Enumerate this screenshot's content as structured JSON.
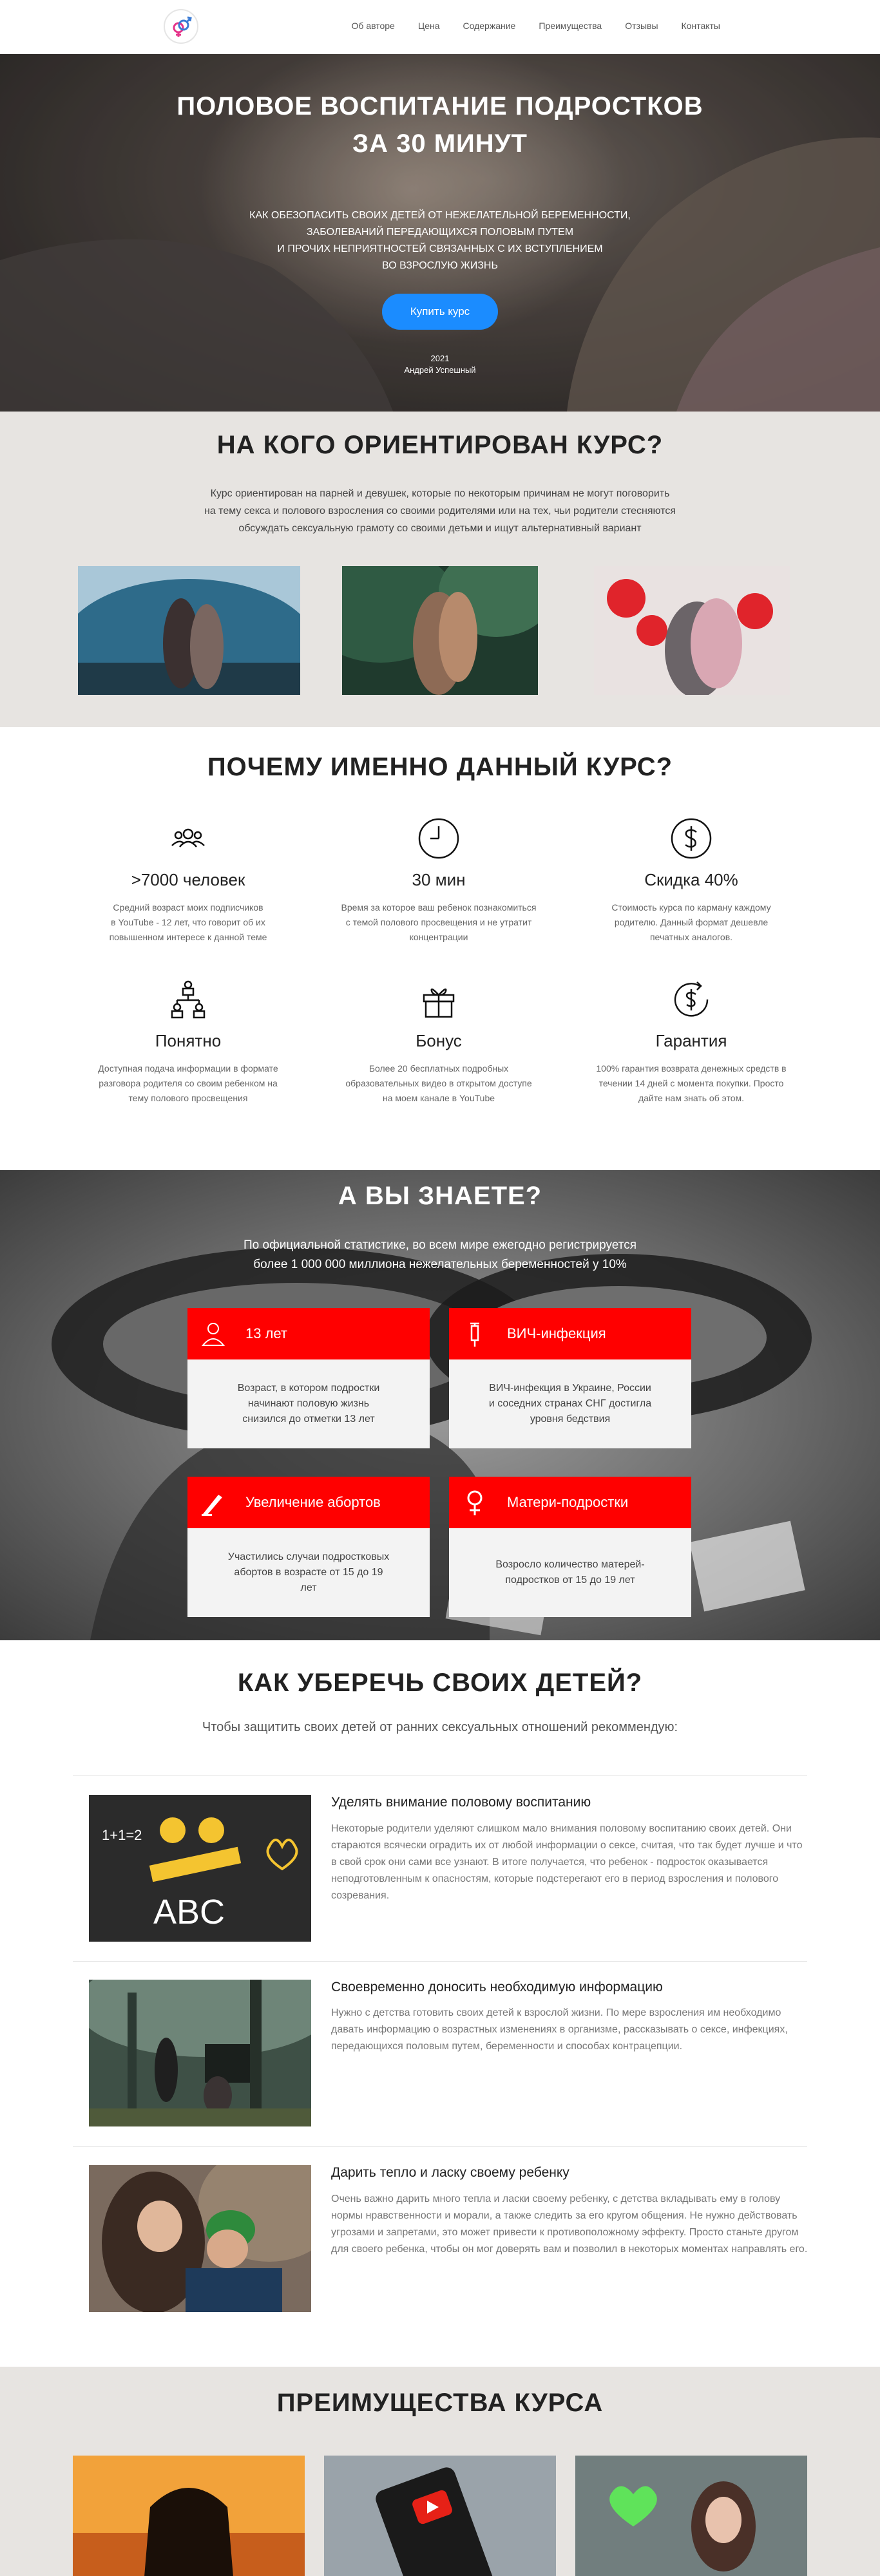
{
  "nav": {
    "items": [
      "Об авторе",
      "Цена",
      "Содержание",
      "Преимущества",
      "Отзывы",
      "Контакты"
    ]
  },
  "hero": {
    "title_line1": "ПОЛОВОЕ ВОСПИТАНИЕ ПОДРОСТКОВ",
    "title_line2": "ЗА 30 МИНУТ",
    "subtitle_lines": [
      "КАК ОБЕЗОПАСИТЬ СВОИХ ДЕТЕЙ ОТ НЕЖЕЛАТЕЛЬНОЙ БЕРЕМЕННОСТИ,",
      "ЗАБОЛЕВАНИЙ ПЕРЕДАЮЩИХСЯ ПОЛОВЫМ ПУТЕМ",
      "И ПРОЧИХ НЕПРИЯТНОСТЕЙ СВЯЗАННЫХ С ИХ ВСТУПЛЕНИЕМ",
      "ВО ВЗРОСЛУЮ ЖИЗНЬ"
    ],
    "button_label": "Купить курс",
    "year": "2021",
    "author": "Андрей Успешный"
  },
  "audience": {
    "title": "НА КОГО ОРИЕНТИРОВАН КУРС?",
    "desc_lines": [
      "Курс ориентирован на парней и девушек, которые по некоторым причинам не могут поговорить",
      "на тему секса и полового взросления со своими родителями или на тех, чьи родители стесняются",
      "обсуждать сексуальную грамоту со своими детьми и ищут альтернативный вариант"
    ]
  },
  "why": {
    "title": "ПОЧЕМУ ИМЕННО ДАННЫЙ КУРС?",
    "features": [
      {
        "icon": "people-icon",
        "title": ">7000 человек",
        "text": [
          "Средний возраст моих подписчиков",
          "в YouTube - 12 лет, что говорит об их",
          "повышенном интересе к данной теме"
        ]
      },
      {
        "icon": "clock-icon",
        "title": "30 мин",
        "text": [
          "Время за которое ваш ребенок познакомиться",
          "с темой полового просвещения и не утратит",
          "концентрации"
        ]
      },
      {
        "icon": "dollar-icon",
        "title": "Скидка 40%",
        "text": [
          "Стоимость курса по карману каждому",
          "родителю. Данный формат дешевле",
          "печатных аналогов."
        ]
      },
      {
        "icon": "network-icon",
        "title": "Понятно",
        "text": [
          "Доступная подача информации в формате",
          "разговора родителя со своим ребенком на",
          "тему полового просвещения"
        ]
      },
      {
        "icon": "gift-icon",
        "title": "Бонус",
        "text": [
          "Более 20 бесплатных подробных",
          "образовательных видео в открытом доступе",
          "на моем канале в YouTube"
        ]
      },
      {
        "icon": "money-back-icon",
        "title": "Гарантия",
        "text": [
          "100% гарантия возврата денежных средств в",
          "течении 14 дней с момента покупки. Просто",
          "дайте нам знать об этом."
        ]
      }
    ]
  },
  "facts": {
    "title": "А ВЫ ЗНАЕТЕ?",
    "desc_lines": [
      "По официальной статистике, во всем мире ежегодно регистрируется",
      "более 1 000 000 миллиона нежелательных беременностей у 10%"
    ],
    "cards": [
      {
        "icon": "person-icon",
        "title": "13 лет",
        "text": "Возраст, в котором подростки начинают половую жизнь снизился до отметки 13 лет"
      },
      {
        "icon": "syringe-icon",
        "title": "ВИЧ-инфекция",
        "text": "ВИЧ-инфекция в Украине, России и соседних странах СНГ достигла уровня бедствия"
      },
      {
        "icon": "scalpel-icon",
        "title": "Увеличение абортов",
        "text": "Участились случаи подростковых абортов в возрасте от 15 до 19 лет"
      },
      {
        "icon": "female-icon",
        "title": "Матери-подростки",
        "text": "Возросло количество матерей-подростков от 15 до 19 лет"
      }
    ]
  },
  "protect": {
    "title": "КАК УБЕРЕЧЬ СВОИХ ДЕТЕЙ?",
    "desc": "Чтобы защитить своих детей от ранних сексуальных отношений рекоммендую:",
    "items": [
      {
        "title": "Уделять внимание половому воспитанию",
        "text": "Некоторые родители уделяют слишком мало внимания половому воспитанию своих детей. Они стараются всячески оградить их от любой информации о сексе, считая, что так будет лучше и что в свой срок они сами все узнают. В итоге получается, что ребенок - подросток оказывается неподготовленным к опасностям, которые подстерегают его в период взросления и полового созревания."
      },
      {
        "title": "Своевременно доносить необходимую информацию",
        "text": "Нужно с детства готовить своих детей к взрослой жизни. По мере взросления им необходимо давать информацию о возрастных изменениях в организме, рассказывать о сексе, инфекциях, передающихся половым путем, беременности и способах контрацепции."
      },
      {
        "title": "Дарить тепло и ласку своему ребенку",
        "text": "Очень важно дарить много тепла и ласки своему ребенку, с детства вкладывать ему в голову нормы нравственности и морали, а также следить за его кругом общения. Не нужно действовать угрозами и запретами, это может привести к противоположному эффекту. Просто станьте другом для своего ребенка, чтобы он мог доверять вам и позволил в некоторых моментах направлять его."
      }
    ]
  },
  "advantages": {
    "title": "ПРЕИМУЩЕСТВА КУРСА"
  },
  "colors": {
    "accent_red": "#ff0000",
    "button_blue": "#1b8cff"
  }
}
